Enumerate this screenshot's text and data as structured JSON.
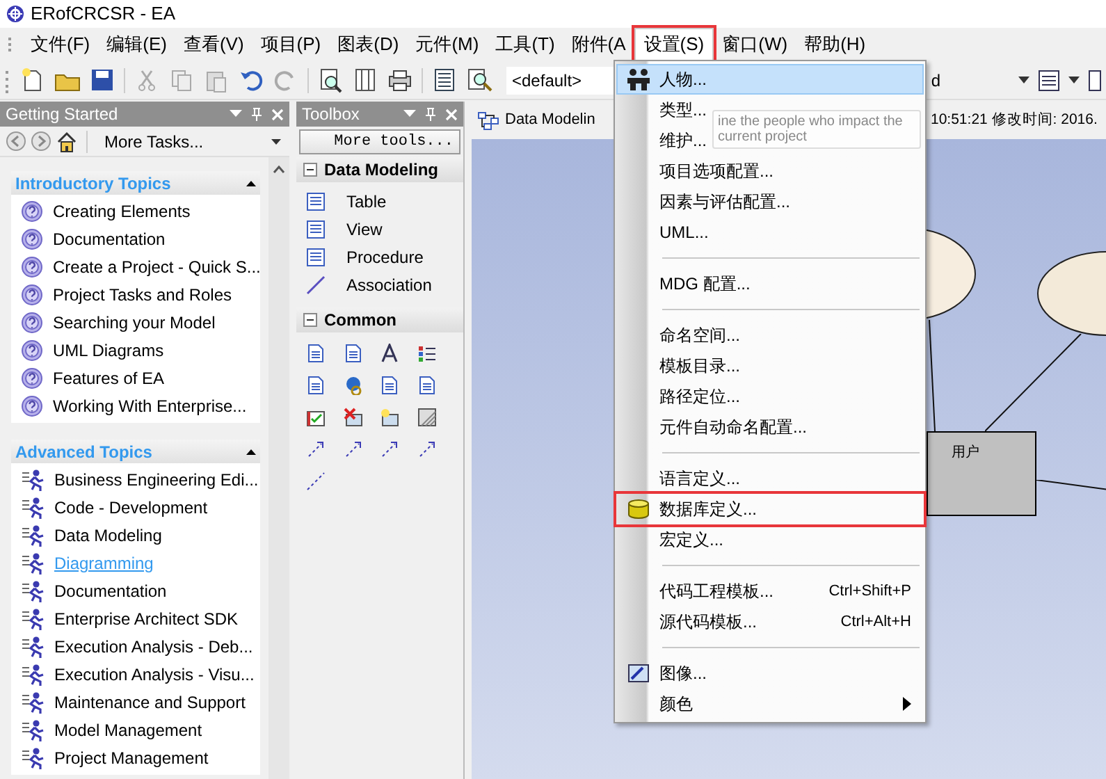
{
  "window": {
    "title": "ERofCRCSR - EA"
  },
  "menu_bar": [
    {
      "label": "文件(F)",
      "selected": false,
      "annotated": false
    },
    {
      "label": "编辑(E)",
      "selected": false,
      "annotated": false
    },
    {
      "label": "查看(V)",
      "selected": false,
      "annotated": false
    },
    {
      "label": "项目(P)",
      "selected": false,
      "annotated": false
    },
    {
      "label": "图表(D)",
      "selected": false,
      "annotated": false
    },
    {
      "label": "元件(M)",
      "selected": false,
      "annotated": false
    },
    {
      "label": "工具(T)",
      "selected": false,
      "annotated": false
    },
    {
      "label": "附件(A",
      "selected": false,
      "annotated": false
    },
    {
      "label": "设置(S)",
      "selected": true,
      "annotated": true
    },
    {
      "label": "窗口(W)",
      "selected": false,
      "annotated": false
    },
    {
      "label": "帮助(H)",
      "selected": false,
      "annotated": false
    }
  ],
  "toolbar": {
    "perspective": "<default>",
    "second_dropdown": "d"
  },
  "getting_started": {
    "title": "Getting Started",
    "more_tasks": "More Tasks...",
    "sections": [
      {
        "title": "Introductory Topics",
        "kind": "help",
        "items": [
          {
            "label": "Creating Elements",
            "hovered": false
          },
          {
            "label": "Documentation",
            "hovered": false
          },
          {
            "label": "Create a Project - Quick S...",
            "hovered": false
          },
          {
            "label": "Project Tasks and Roles",
            "hovered": false
          },
          {
            "label": "Searching your Model",
            "hovered": false
          },
          {
            "label": "UML Diagrams",
            "hovered": false
          },
          {
            "label": "Features of EA",
            "hovered": false
          },
          {
            "label": "Working With Enterprise...",
            "hovered": false
          }
        ]
      },
      {
        "title": "Advanced Topics",
        "kind": "task",
        "items": [
          {
            "label": "Business Engineering Edi...",
            "hovered": false
          },
          {
            "label": "Code - Development",
            "hovered": false
          },
          {
            "label": "Data Modeling",
            "hovered": false
          },
          {
            "label": "Diagramming",
            "hovered": true
          },
          {
            "label": "Documentation",
            "hovered": false
          },
          {
            "label": "Enterprise Architect SDK",
            "hovered": false
          },
          {
            "label": "Execution Analysis - Deb...",
            "hovered": false
          },
          {
            "label": "Execution Analysis - Visu...",
            "hovered": false
          },
          {
            "label": "Maintenance and Support",
            "hovered": false
          },
          {
            "label": "Model Management",
            "hovered": false
          },
          {
            "label": "Project Management",
            "hovered": false
          }
        ]
      }
    ]
  },
  "toolbox": {
    "title": "Toolbox",
    "more_tools": "More tools...",
    "sections": [
      {
        "title": "Data Modeling",
        "kind": "list",
        "items": [
          {
            "label": "Table"
          },
          {
            "label": "View"
          },
          {
            "label": "Procedure"
          },
          {
            "label": "Association"
          }
        ]
      },
      {
        "title": "Common",
        "kind": "grid"
      }
    ]
  },
  "diagram": {
    "tab": "Data Modelin",
    "info": "10:51:21 修改时间: 2016.",
    "entity": "用户"
  },
  "context_menu": {
    "items": [
      {
        "kind": "item",
        "label": "人物...",
        "selected": true,
        "annotated": false
      },
      {
        "kind": "item",
        "label": "类型...",
        "selected": false,
        "annotated": false
      },
      {
        "kind": "item",
        "label": "维护...",
        "selected": false,
        "annotated": false
      },
      {
        "kind": "item",
        "label": "项目选项配置...",
        "selected": false,
        "annotated": false
      },
      {
        "kind": "item",
        "label": "因素与评估配置...",
        "selected": false,
        "annotated": false
      },
      {
        "kind": "item",
        "label": "UML...",
        "selected": false,
        "annotated": false
      },
      {
        "kind": "separator"
      },
      {
        "kind": "item",
        "label": "MDG 配置...",
        "selected": false,
        "annotated": false
      },
      {
        "kind": "separator"
      },
      {
        "kind": "item",
        "label": "命名空间...",
        "selected": false,
        "annotated": false
      },
      {
        "kind": "item",
        "label": "模板目录...",
        "selected": false,
        "annotated": false
      },
      {
        "kind": "item",
        "label": "路径定位...",
        "selected": false,
        "annotated": false
      },
      {
        "kind": "item",
        "label": "元件自动命名配置...",
        "selected": false,
        "annotated": false
      },
      {
        "kind": "separator"
      },
      {
        "kind": "item",
        "label": "语言定义...",
        "selected": false,
        "annotated": false
      },
      {
        "kind": "item",
        "label": "数据库定义...",
        "selected": false,
        "annotated": true
      },
      {
        "kind": "item",
        "label": "宏定义...",
        "selected": false,
        "annotated": false
      },
      {
        "kind": "separator"
      },
      {
        "kind": "item",
        "label": "代码工程模板...",
        "shortcut": "Ctrl+Shift+P",
        "selected": false,
        "annotated": false
      },
      {
        "kind": "item",
        "label": "源代码模板...",
        "shortcut": "Ctrl+Alt+H",
        "selected": false,
        "annotated": false
      },
      {
        "kind": "separator"
      },
      {
        "kind": "item",
        "label": "图像...",
        "selected": false,
        "annotated": false
      },
      {
        "kind": "item",
        "label": "颜色",
        "submenu": true,
        "selected": false,
        "annotated": false
      }
    ]
  },
  "tooltip": {
    "text": "ine the people who impact the current project"
  }
}
